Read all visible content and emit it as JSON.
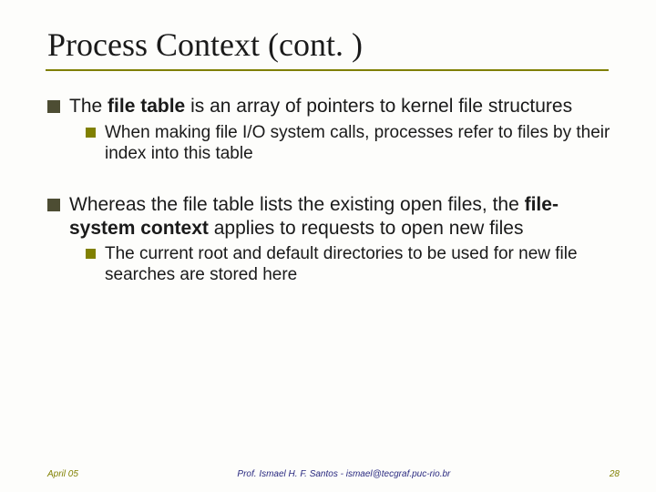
{
  "title": "Process Context (cont. )",
  "bullets": {
    "b1_pre": "The ",
    "b1_bold": "file table",
    "b1_post": " is an array of pointers to kernel file structures",
    "b1_sub1": "When making file I/O system calls, processes refer to files by their index into this table",
    "b2_pre": "Whereas the file table lists the existing open files, the ",
    "b2_bold": "file-system context",
    "b2_post": " applies to requests to open new files",
    "b2_sub1": "The current root and default directories to be used for new file searches are stored here"
  },
  "footer": {
    "date": "April 05",
    "author": "Prof. Ismael H. F. Santos - ismael@tecgraf.puc-rio.br",
    "page": "28"
  }
}
